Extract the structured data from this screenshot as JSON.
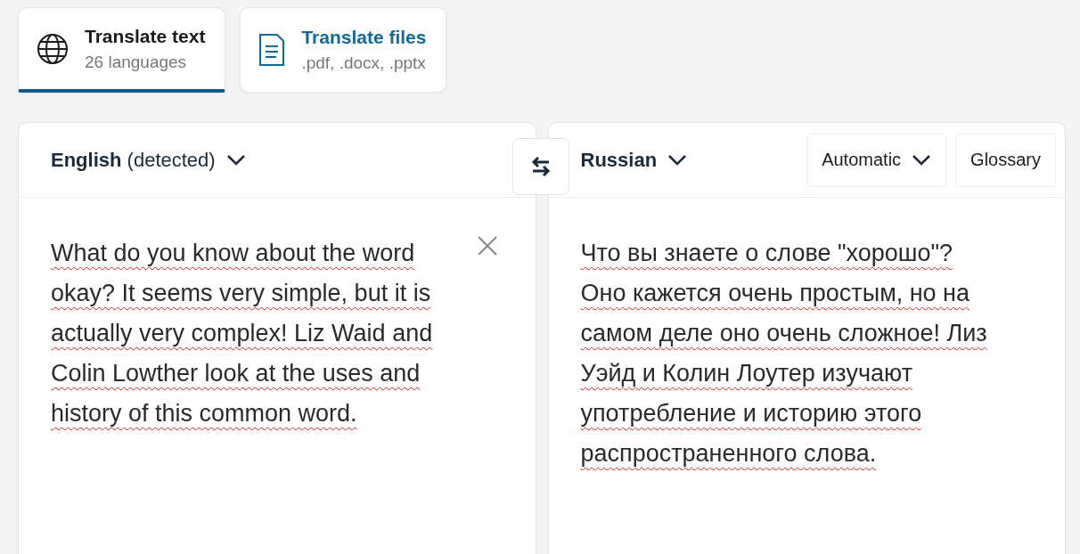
{
  "tabs": [
    {
      "kind": "text",
      "title": "Translate text",
      "subtitle": "26 languages",
      "selected": true
    },
    {
      "kind": "files",
      "title": "Translate files",
      "subtitle": ".pdf, .docx, .pptx",
      "selected": false
    }
  ],
  "source": {
    "language": "English",
    "note": "(detected)",
    "text": "What do you know about the word okay? It seems very simple, but it is actually very complex! Liz Waid and Colin Lowther look at the uses and history of this common word.",
    "spellcheck_underline": true
  },
  "target": {
    "language": "Russian",
    "formality": "Automatic",
    "glossary": "Glossary",
    "text": "Что вы знаете о слове \"хорошо\"? Оно кажется очень простым, но на самом деле оно очень сложное! Лиз Уэйд и Колин Лоутер изучают употребление и историю этого распространенного слова.",
    "spellcheck_underline": true
  }
}
